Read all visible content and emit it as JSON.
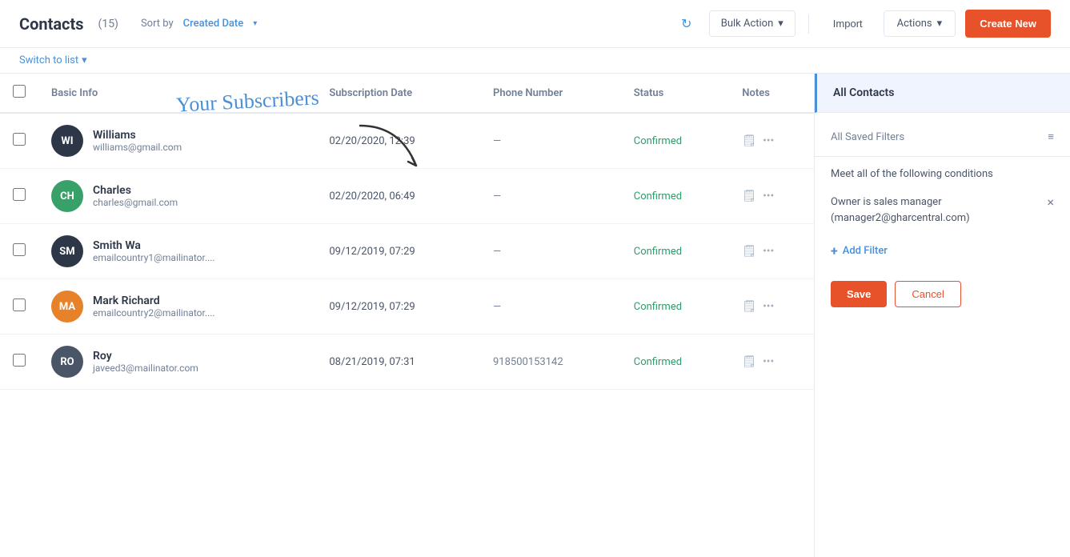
{
  "header": {
    "title": "Contacts",
    "count": "(15)",
    "sort_label": "Sort by",
    "sort_value": "Created Date",
    "refresh_icon": "↻",
    "bulk_action_label": "Bulk Action",
    "import_label": "Import",
    "actions_label": "Actions",
    "create_new_label": "Create New",
    "switch_list_label": "Switch to list"
  },
  "table": {
    "columns": [
      "Basic Info",
      "Subscription Date",
      "Phone Number",
      "Status",
      "Notes"
    ],
    "rows": [
      {
        "initials": "WI",
        "avatar_color": "#2d3748",
        "name": "Williams",
        "email": "williams@gmail.com",
        "subscription_date": "02/20/2020, 12:39",
        "phone": "—",
        "status": "Confirmed"
      },
      {
        "initials": "CH",
        "avatar_color": "#38a169",
        "name": "Charles",
        "email": "charles@gmail.com",
        "subscription_date": "02/20/2020, 06:49",
        "phone": "—",
        "status": "Confirmed"
      },
      {
        "initials": "SM",
        "avatar_color": "#2d3748",
        "name": "Smith Wa",
        "email": "emailcountry1@mailinator....",
        "subscription_date": "09/12/2019, 07:29",
        "phone": "—",
        "status": "Confirmed"
      },
      {
        "initials": "MA",
        "avatar_color": "#e8822a",
        "name": "Mark Richard",
        "email": "emailcountry2@mailinator....",
        "subscription_date": "09/12/2019, 07:29",
        "phone": "—",
        "status": "Confirmed"
      },
      {
        "initials": "RO",
        "avatar_color": "#4a5568",
        "name": "Roy",
        "email": "javeed3@mailinator.com",
        "subscription_date": "08/21/2019, 07:31",
        "phone": "918500153142",
        "status": "Confirmed"
      }
    ]
  },
  "annotation": {
    "text": "Your Subscribers"
  },
  "right_panel": {
    "all_contacts_label": "All Contacts",
    "saved_filters_label": "All Saved Filters",
    "conditions_label": "Meet all of the following conditions",
    "filter_text": "Owner is sales manager\n(manager2@gharcentral.com)",
    "add_filter_label": "Add Filter",
    "save_label": "Save",
    "cancel_label": "Cancel"
  }
}
